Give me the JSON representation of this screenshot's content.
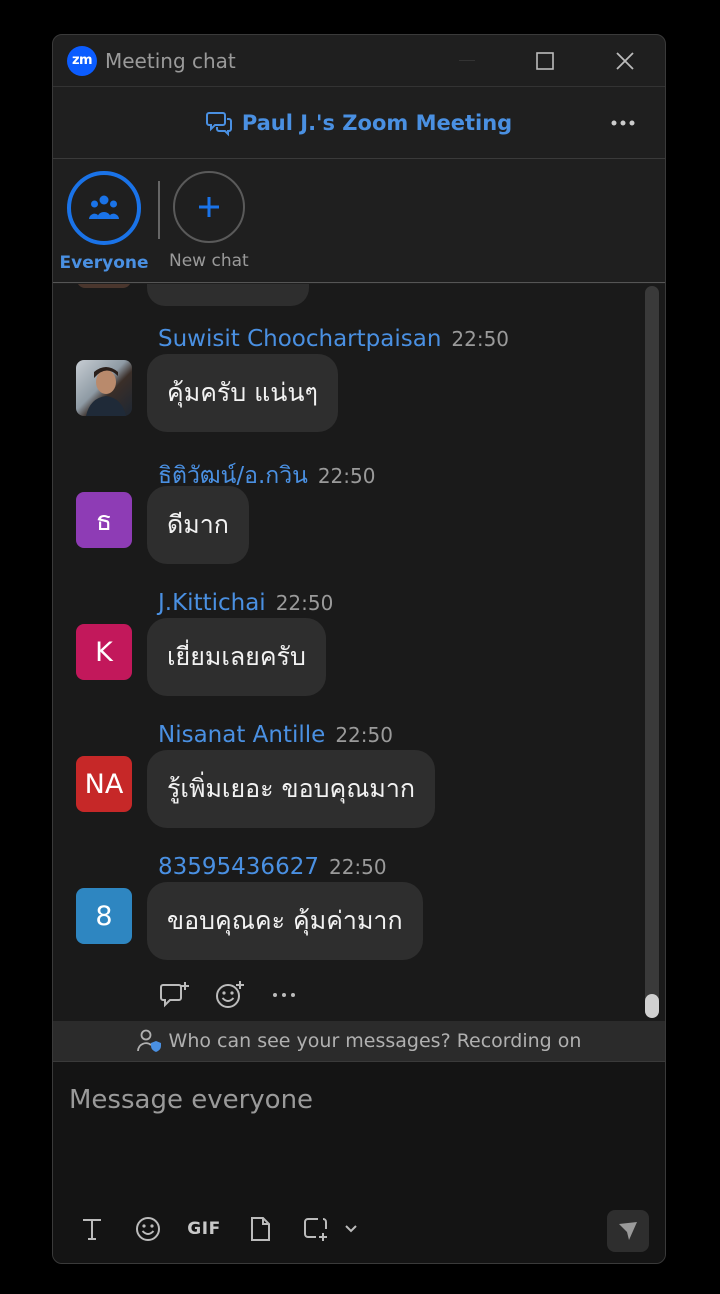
{
  "window": {
    "app_logo": "zm",
    "title": "Meeting chat"
  },
  "header": {
    "meeting_title": "Paul J.'s Zoom Meeting"
  },
  "tabs": [
    {
      "label": "Everyone",
      "icon": "group-icon",
      "selected": true
    },
    {
      "label": "New chat",
      "icon": "plus-icon",
      "selected": false
    }
  ],
  "messages": [
    {
      "sender": "Suwisit Choochartpaisan",
      "time": "22:50",
      "avatar_text": "",
      "avatar_color": "",
      "avatar_type": "photo",
      "text": "คุ้มครับ แน่นๆ"
    },
    {
      "sender": "ธิติวัฒน์/อ.กวิน",
      "time": "22:50",
      "avatar_text": "ธ",
      "avatar_color": "#8e3cb5",
      "avatar_type": "initial",
      "text": "ดีมาก"
    },
    {
      "sender": "J.Kittichai",
      "time": "22:50",
      "avatar_text": "K",
      "avatar_color": "#c2185b",
      "avatar_type": "initial",
      "text": "เยี่ยมเลยครับ"
    },
    {
      "sender": "Nisanat Antille",
      "time": "22:50",
      "avatar_text": "NA",
      "avatar_color": "#c62828",
      "avatar_type": "initial",
      "text": "รู้เพิ่มเยอะ ขอบคุณมาก"
    },
    {
      "sender": "83595436627",
      "time": "22:50",
      "avatar_text": "8",
      "avatar_color": "#2e86c1",
      "avatar_type": "initial",
      "text": "ขอบคุณคะ คุ้มค่ามาก"
    }
  ],
  "notice": {
    "text": "Who can see your messages? Recording on"
  },
  "composer": {
    "placeholder": "Message everyone",
    "gif_label": "GIF"
  },
  "colors": {
    "accent": "#4a90e2",
    "brand": "#0b5cff"
  }
}
